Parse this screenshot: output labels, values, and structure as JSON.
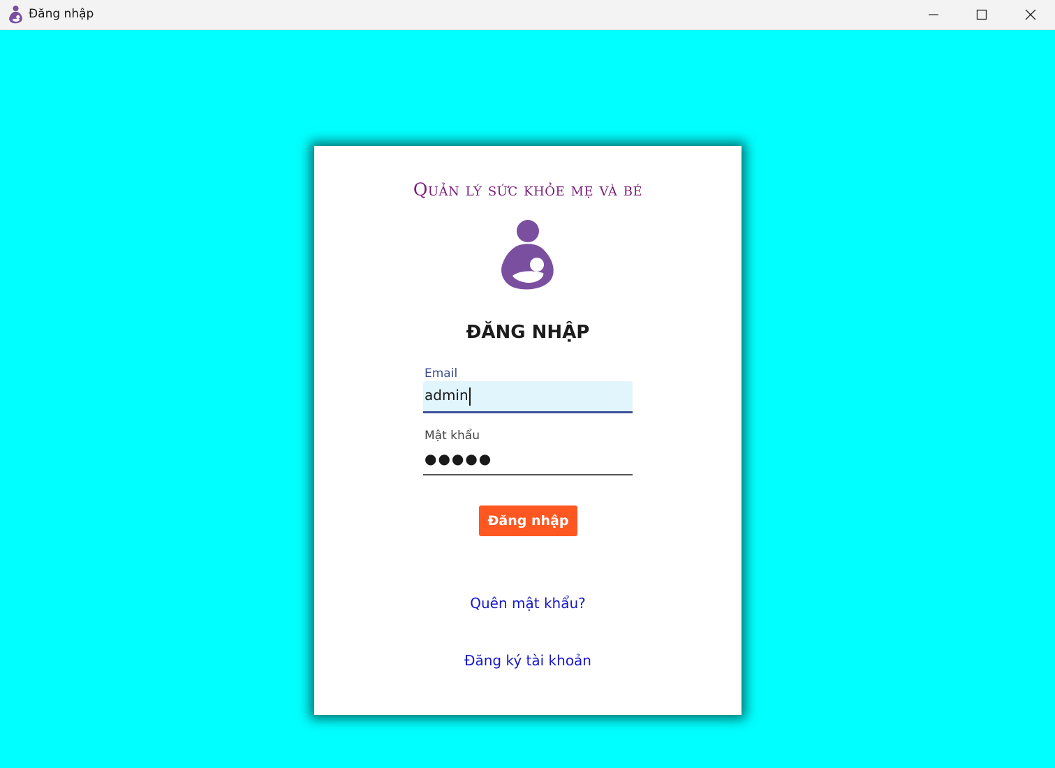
{
  "window": {
    "title": "Đăng nhập",
    "app_icon": "mother-baby-icon"
  },
  "window_controls": {
    "minimize_icon": "minimize-icon",
    "maximize_icon": "maximize-icon",
    "close_icon": "close-icon"
  },
  "colors": {
    "background": "#00ffff",
    "app_title": "#7a1b7a",
    "logo": "#7b4fa0",
    "primary_button": "#ff5722",
    "link": "#1818c8",
    "input_focus_bg": "#e1f5fc",
    "input_focus_border": "#3b4f9a"
  },
  "login": {
    "app_title": "Quản lý sức khỏe mẹ và bé",
    "logo_icon": "mother-baby-icon",
    "heading": "ĐĂNG NHẬP",
    "email": {
      "label": "Email",
      "value": "admin"
    },
    "password": {
      "label": "Mật khẩu",
      "masked_value": "●●●●●"
    },
    "submit_label": "Đăng nhập",
    "forgot_password_label": "Quên mật khẩu?",
    "register_label": "Đăng ký tài khoản"
  }
}
